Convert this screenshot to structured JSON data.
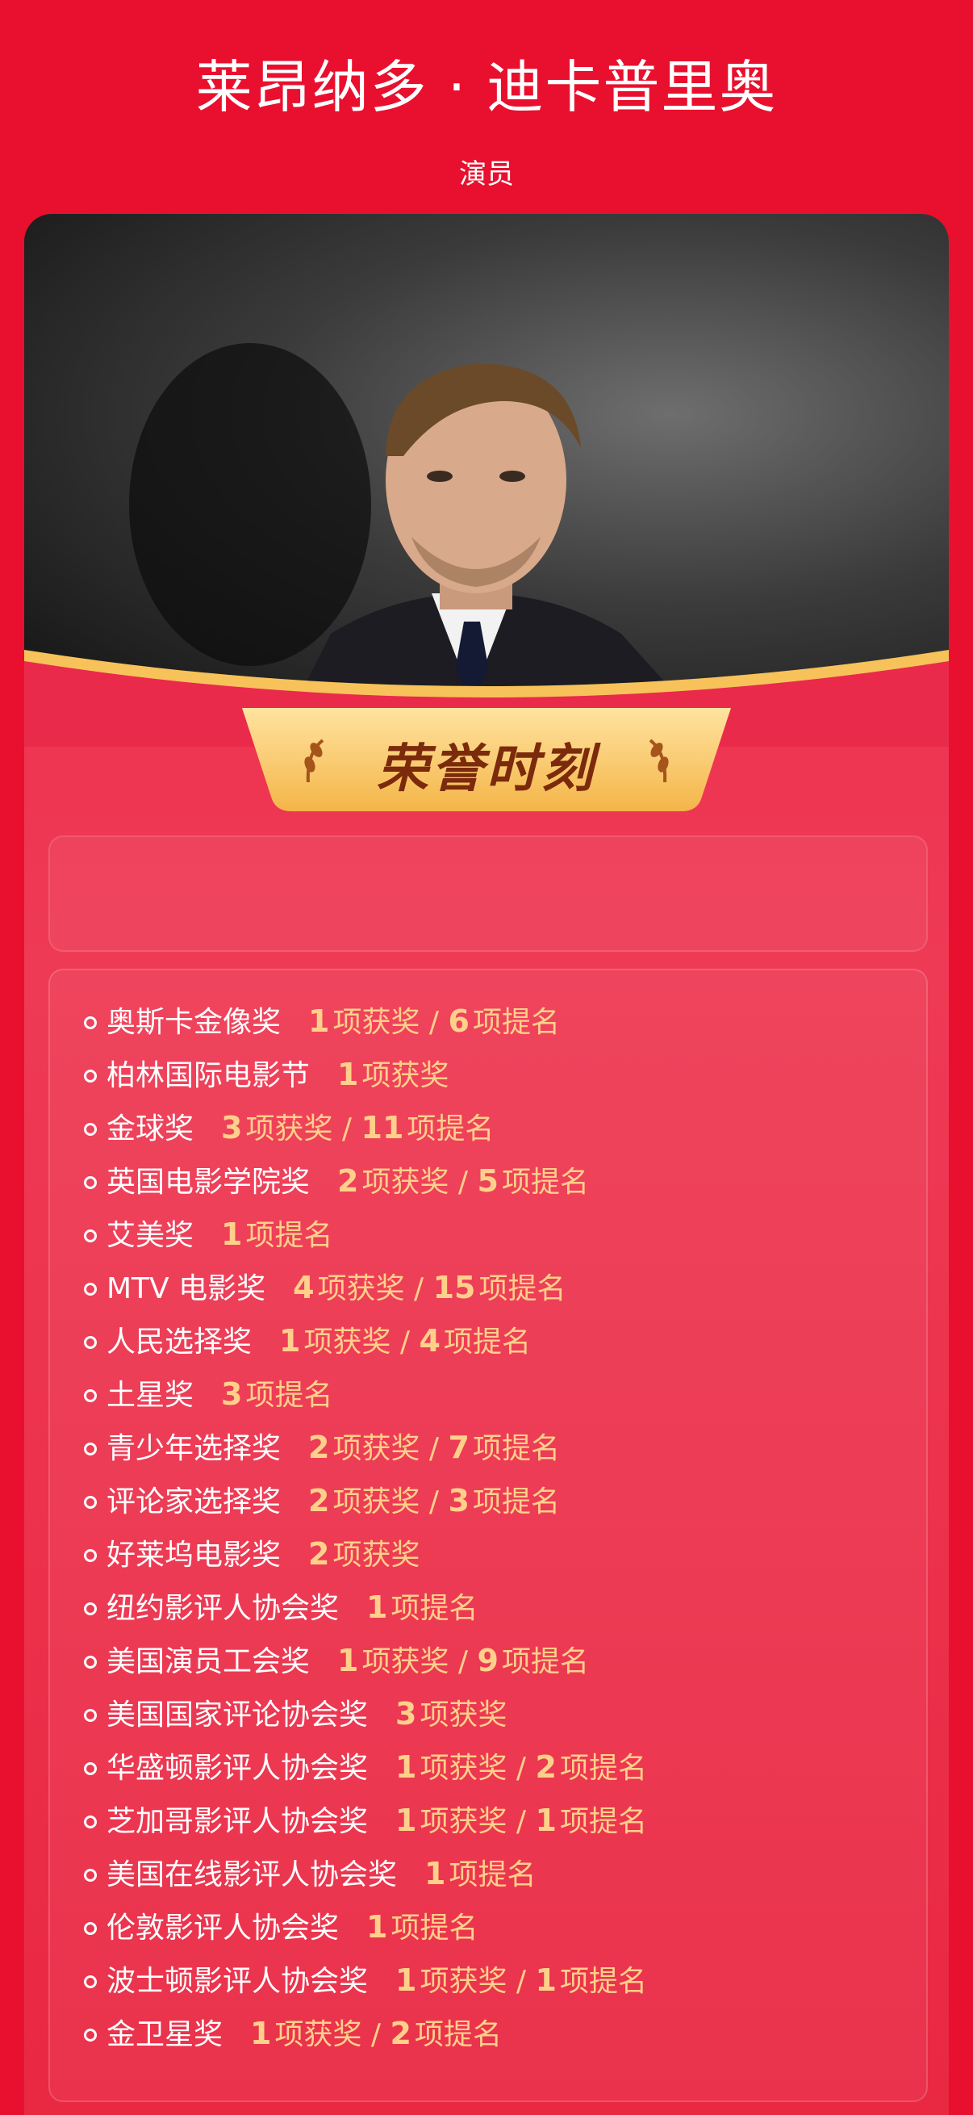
{
  "header": {
    "title": "莱昂纳多 · 迪卡普里奥",
    "subtitle": "演员"
  },
  "banner": {
    "title": "荣誉时刻"
  },
  "colors": {
    "background": "#e8102e",
    "highlight": "#ffd08a",
    "banner_gold": "#f7c25a"
  },
  "awards": [
    {
      "name": "奥斯卡金像奖",
      "stats": [
        {
          "num": "1",
          "label": "项获奖"
        },
        {
          "num": "6",
          "label": "项提名"
        }
      ]
    },
    {
      "name": "柏林国际电影节",
      "stats": [
        {
          "num": "1",
          "label": "项获奖"
        }
      ]
    },
    {
      "name": "金球奖",
      "stats": [
        {
          "num": "3",
          "label": "项获奖"
        },
        {
          "num": "11",
          "label": "项提名"
        }
      ]
    },
    {
      "name": "英国电影学院奖",
      "stats": [
        {
          "num": "2",
          "label": "项获奖"
        },
        {
          "num": "5",
          "label": "项提名"
        }
      ]
    },
    {
      "name": "艾美奖",
      "stats": [
        {
          "num": "1",
          "label": "项提名"
        }
      ]
    },
    {
      "name": "MTV 电影奖",
      "stats": [
        {
          "num": "4",
          "label": "项获奖"
        },
        {
          "num": "15",
          "label": "项提名"
        }
      ]
    },
    {
      "name": "人民选择奖",
      "stats": [
        {
          "num": "1",
          "label": "项获奖"
        },
        {
          "num": "4",
          "label": "项提名"
        }
      ]
    },
    {
      "name": "土星奖",
      "stats": [
        {
          "num": "3",
          "label": "项提名"
        }
      ]
    },
    {
      "name": "青少年选择奖",
      "stats": [
        {
          "num": "2",
          "label": "项获奖"
        },
        {
          "num": "7",
          "label": "项提名"
        }
      ]
    },
    {
      "name": "评论家选择奖",
      "stats": [
        {
          "num": "2",
          "label": "项获奖"
        },
        {
          "num": "3",
          "label": "项提名"
        }
      ]
    },
    {
      "name": "好莱坞电影奖",
      "stats": [
        {
          "num": "2",
          "label": "项获奖"
        }
      ]
    },
    {
      "name": "纽约影评人协会奖",
      "stats": [
        {
          "num": "1",
          "label": "项提名"
        }
      ]
    },
    {
      "name": "美国演员工会奖",
      "stats": [
        {
          "num": "1",
          "label": "项获奖"
        },
        {
          "num": "9",
          "label": "项提名"
        }
      ]
    },
    {
      "name": "美国国家评论协会奖",
      "stats": [
        {
          "num": "3",
          "label": "项获奖"
        }
      ]
    },
    {
      "name": "华盛顿影评人协会奖",
      "stats": [
        {
          "num": "1",
          "label": "项获奖"
        },
        {
          "num": "2",
          "label": "项提名"
        }
      ]
    },
    {
      "name": "芝加哥影评人协会奖",
      "stats": [
        {
          "num": "1",
          "label": "项获奖"
        },
        {
          "num": "1",
          "label": "项提名"
        }
      ]
    },
    {
      "name": "美国在线影评人协会奖",
      "stats": [
        {
          "num": "1",
          "label": "项提名"
        }
      ]
    },
    {
      "name": "伦敦影评人协会奖",
      "stats": [
        {
          "num": "1",
          "label": "项提名"
        }
      ]
    },
    {
      "name": "波士顿影评人协会奖",
      "stats": [
        {
          "num": "1",
          "label": "项获奖"
        },
        {
          "num": "1",
          "label": "项提名"
        }
      ]
    },
    {
      "name": "金卫星奖",
      "stats": [
        {
          "num": "1",
          "label": "项获奖"
        },
        {
          "num": "2",
          "label": "项提名"
        }
      ]
    }
  ]
}
